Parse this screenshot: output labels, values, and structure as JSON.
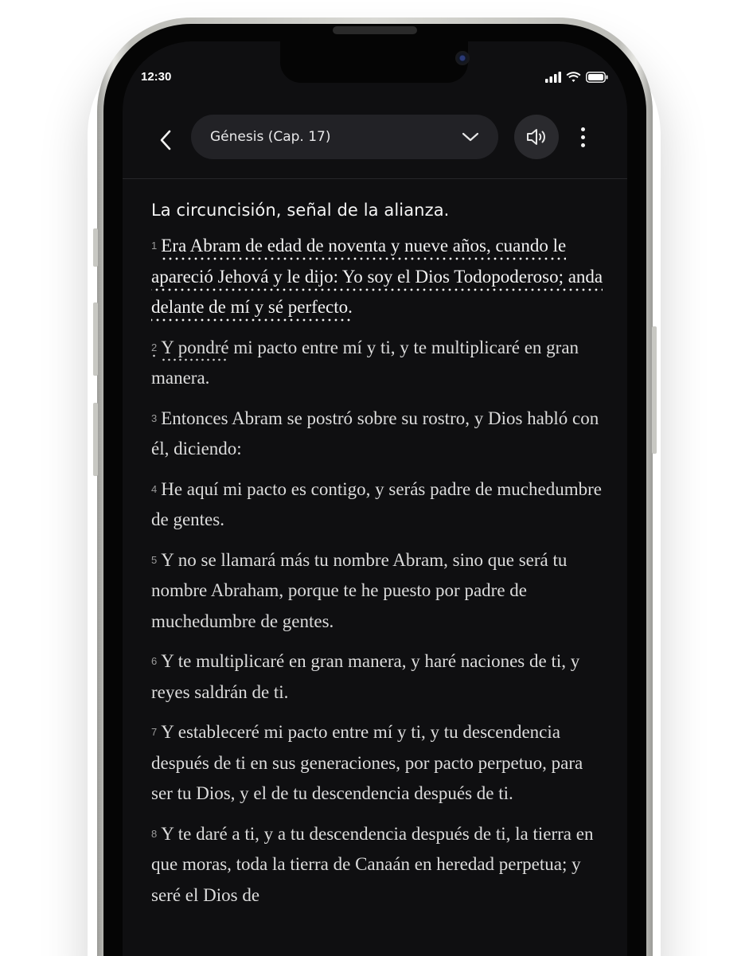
{
  "status_bar": {
    "time": "12:30",
    "icons": [
      "signal-icon",
      "wifi-icon",
      "battery-icon"
    ]
  },
  "header": {
    "chapter_label": "Génesis (Cap. 17)",
    "icons": [
      "back-chevron-icon",
      "chevron-down-icon",
      "speaker-icon",
      "more-vertical-icon"
    ]
  },
  "reading": {
    "section_title": "La circuncisión, señal de la alianza.",
    "verses": [
      {
        "num": "1",
        "text": "Era Abram de edad de noventa y nueve años, cuando le apareció Jehová y le dijo: Yo soy el Dios Todopoderoso; anda delante de mí y sé perfecto."
      },
      {
        "num": "2",
        "text_marked": "Y pondré",
        "text": " mi pacto entre mí y ti, y te multiplicaré en gran manera."
      },
      {
        "num": "3",
        "text": "Entonces Abram se postró sobre su rostro, y Dios habló con él, diciendo:"
      },
      {
        "num": "4",
        "text": "He aquí mi pacto es contigo, y serás padre de muchedumbre de gentes."
      },
      {
        "num": "5",
        "text": "Y no se llamará más tu nombre Abram, sino que será tu nombre Abraham, porque te he puesto por padre de muchedumbre de gentes."
      },
      {
        "num": "6",
        "text": "Y te multiplicaré en gran manera, y haré naciones de ti, y reyes saldrán de ti."
      },
      {
        "num": "7",
        "text": "Y estableceré mi pacto entre mí y ti, y tu descendencia después de ti en sus generaciones, por pacto perpetuo, para ser tu Dios, y el de tu descendencia después de ti."
      },
      {
        "num": "8",
        "text": "Y te daré a ti, y a tu descendencia después de ti, la tierra en que moras, toda la tierra de Canaán en heredad perpetua; y seré el Dios de"
      }
    ]
  },
  "colors": {
    "screen_bg": "#0f0f11",
    "pill_bg": "#222226",
    "text": "#dcdcdc",
    "title": "#f4f4f4"
  }
}
